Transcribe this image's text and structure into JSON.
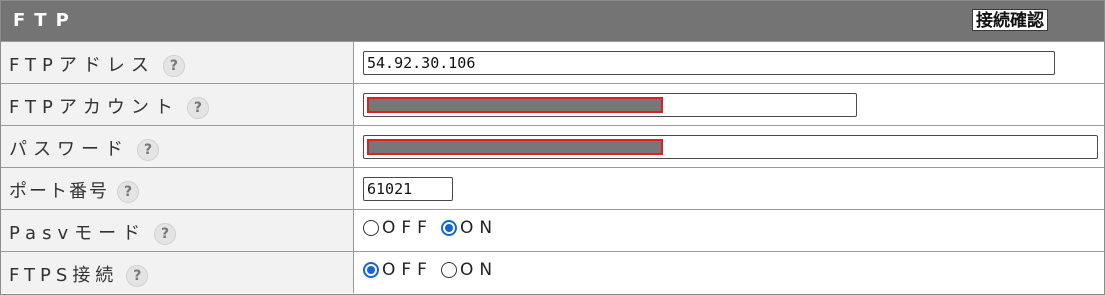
{
  "header": {
    "title": "FTP",
    "check_button": "接続確認"
  },
  "rows": [
    {
      "label": "FTPアドレス",
      "help": "?",
      "value": "54.92.30.106"
    },
    {
      "label": "FTPアカウント",
      "help": "?",
      "value": ""
    },
    {
      "label": "パスワード",
      "help": "?",
      "value": ""
    },
    {
      "label": "ポート番号",
      "help": "?",
      "value": "61021"
    },
    {
      "label": "Pasvモード",
      "help": "?",
      "options": [
        "OFF",
        "ON"
      ],
      "selected": "ON"
    },
    {
      "label": "FTPS接続",
      "help": "?",
      "options": [
        "OFF",
        "ON"
      ],
      "selected": "OFF"
    }
  ],
  "colors": {
    "header_bg": "#747474",
    "label_bg": "#f2f2f2",
    "radio_selected": "#1565d8",
    "redaction_border": "#e02020"
  }
}
